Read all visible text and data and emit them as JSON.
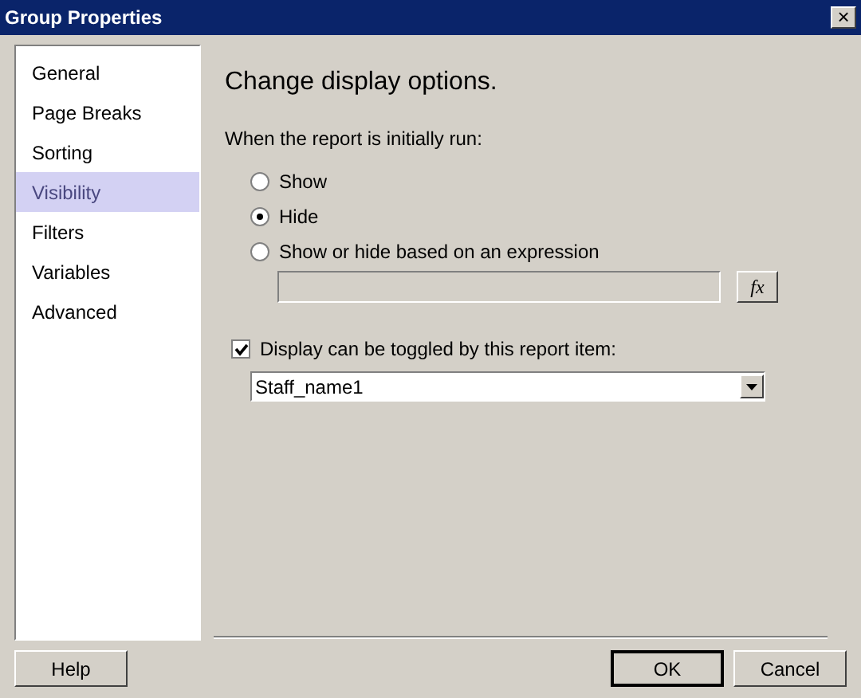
{
  "window": {
    "title": "Group Properties",
    "close": "×"
  },
  "sidebar": {
    "items": [
      {
        "label": "General",
        "selected": false
      },
      {
        "label": "Page Breaks",
        "selected": false
      },
      {
        "label": "Sorting",
        "selected": false
      },
      {
        "label": "Visibility",
        "selected": true
      },
      {
        "label": "Filters",
        "selected": false
      },
      {
        "label": "Variables",
        "selected": false
      },
      {
        "label": "Advanced",
        "selected": false
      }
    ]
  },
  "heading": "Change display options.",
  "initial_label": "When the report is initially run:",
  "options": [
    {
      "label": "Show",
      "selected": false
    },
    {
      "label": "Hide",
      "selected": true
    },
    {
      "label": "Show or hide based on an expression",
      "selected": false
    }
  ],
  "expression": {
    "disabled": true,
    "button": "fx"
  },
  "toggle": {
    "label": "Display can be toggled by this report item:",
    "checked": true
  },
  "toggle_item": {
    "value": "Staff_name1"
  },
  "buttons": {
    "help": "Help",
    "ok": "OK",
    "cancel": "Cancel"
  }
}
